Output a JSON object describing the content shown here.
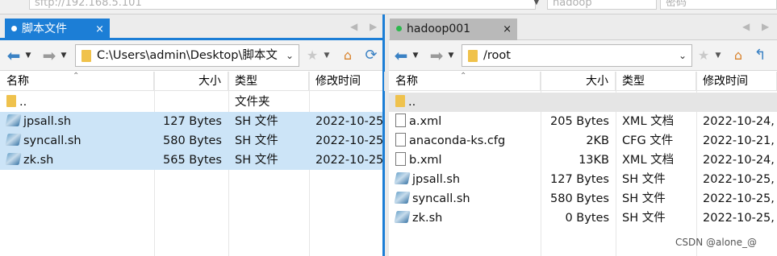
{
  "topbar": {
    "host": "sftp://192.168.5.101",
    "user": "hadoop",
    "password": "密码"
  },
  "left": {
    "tab": {
      "label": "脚本文件",
      "close": "×"
    },
    "path": "C:\\Users\\admin\\Desktop\\脚本文",
    "columns": [
      "名称",
      "大小",
      "类型",
      "修改时间"
    ],
    "rows": [
      {
        "name": "..",
        "size": "",
        "type": "文件夹",
        "mtime": "",
        "icon": "folder"
      },
      {
        "name": "jpsall.sh",
        "size": "127 Bytes",
        "type": "SH 文件",
        "mtime": "2022-10-25",
        "icon": "sh"
      },
      {
        "name": "syncall.sh",
        "size": "580 Bytes",
        "type": "SH 文件",
        "mtime": "2022-10-25",
        "icon": "sh"
      },
      {
        "name": "zk.sh",
        "size": "565 Bytes",
        "type": "SH 文件",
        "mtime": "2022-10-25",
        "icon": "sh"
      }
    ]
  },
  "right": {
    "tab": {
      "label": "hadoop001",
      "close": "×"
    },
    "path": "/root",
    "columns": [
      "名称",
      "大小",
      "类型",
      "修改时间"
    ],
    "rows": [
      {
        "name": "..",
        "size": "",
        "type": "",
        "mtime": "",
        "icon": "folder"
      },
      {
        "name": "a.xml",
        "size": "205 Bytes",
        "type": "XML 文档",
        "mtime": "2022-10-24,",
        "icon": "doc"
      },
      {
        "name": "anaconda-ks.cfg",
        "size": "2KB",
        "type": "CFG 文件",
        "mtime": "2022-10-21,",
        "icon": "doc"
      },
      {
        "name": "b.xml",
        "size": "13KB",
        "type": "XML 文档",
        "mtime": "2022-10-24,",
        "icon": "doc"
      },
      {
        "name": "jpsall.sh",
        "size": "127 Bytes",
        "type": "SH 文件",
        "mtime": "2022-10-25,",
        "icon": "sh"
      },
      {
        "name": "syncall.sh",
        "size": "580 Bytes",
        "type": "SH 文件",
        "mtime": "2022-10-25,",
        "icon": "sh"
      },
      {
        "name": "zk.sh",
        "size": "0 Bytes",
        "type": "SH 文件",
        "mtime": "2022-10-25,",
        "icon": "sh"
      }
    ]
  },
  "watermark": "CSDN @alone_@",
  "colors": {
    "selection": "#cce4f7",
    "active_tab": "#1c7ed6",
    "status_green": "#2db84d",
    "parent_row": "#e5e5e5"
  }
}
